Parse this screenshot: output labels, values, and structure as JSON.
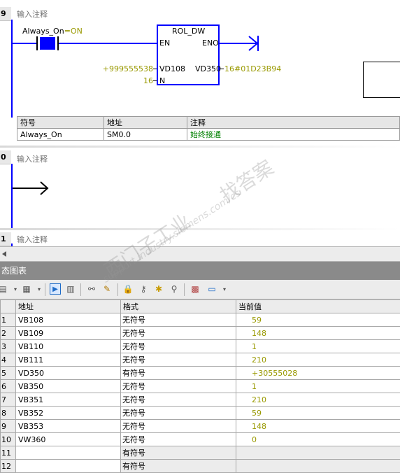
{
  "network9": {
    "number": "9",
    "comment": "输入注释",
    "contact_name": "Always_On",
    "contact_state": "=ON",
    "block": {
      "title": "ROL_DW",
      "en": "EN",
      "eno": "ENO",
      "in_pin": "VD108",
      "out_pin": "VD350",
      "n_pin": "N",
      "in_value": "+999555538",
      "out_value": "16#01D23B94",
      "n_value": "16"
    },
    "symbol_table": {
      "headers": [
        "符号",
        "地址",
        "注释"
      ],
      "rows": [
        [
          "Always_On",
          "SM0.0",
          "始终接通"
        ]
      ]
    }
  },
  "network10": {
    "number": "0",
    "comment": "输入注释"
  },
  "network11": {
    "number": "1",
    "comment": "输入注释"
  },
  "status_chart": {
    "title": "态图表",
    "columns": [
      "地址",
      "格式",
      "当前值"
    ],
    "rows": [
      {
        "n": "1",
        "addr": "VB108",
        "fmt": "无符号",
        "val": "59"
      },
      {
        "n": "2",
        "addr": "VB109",
        "fmt": "无符号",
        "val": "148"
      },
      {
        "n": "3",
        "addr": "VB110",
        "fmt": "无符号",
        "val": "1"
      },
      {
        "n": "4",
        "addr": "VB111",
        "fmt": "无符号",
        "val": "210"
      },
      {
        "n": "5",
        "addr": "VD350",
        "fmt": "有符号",
        "val": "+30555028"
      },
      {
        "n": "6",
        "addr": "VB350",
        "fmt": "无符号",
        "val": "1"
      },
      {
        "n": "7",
        "addr": "VB351",
        "fmt": "无符号",
        "val": "210"
      },
      {
        "n": "8",
        "addr": "VB352",
        "fmt": "无符号",
        "val": "59"
      },
      {
        "n": "9",
        "addr": "VB353",
        "fmt": "无符号",
        "val": "148"
      },
      {
        "n": "10",
        "addr": "VW360",
        "fmt": "无符号",
        "val": "0"
      },
      {
        "n": "11",
        "addr": "",
        "fmt": "有符号",
        "val": ""
      },
      {
        "n": "12",
        "addr": "",
        "fmt": "有符号",
        "val": ""
      }
    ]
  },
  "watermark": {
    "line1": "找答案",
    "line2": "西门子工业",
    "url": "support.industry.siemens.com/cs"
  },
  "colors": {
    "wire": "#0000ff",
    "value": "#999900",
    "comment": "#008000"
  }
}
